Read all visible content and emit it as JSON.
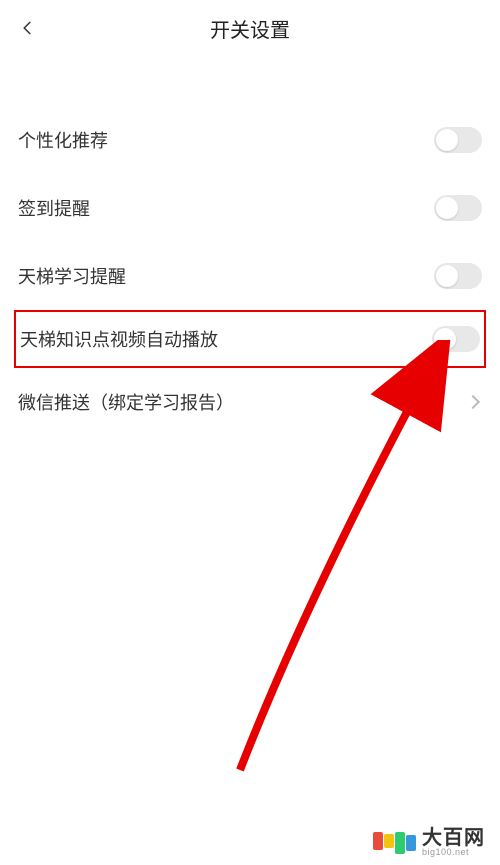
{
  "header": {
    "title": "开关设置"
  },
  "settings": [
    {
      "label": "个性化推荐",
      "type": "toggle",
      "on": false,
      "highlighted": false
    },
    {
      "label": "签到提醒",
      "type": "toggle",
      "on": false,
      "highlighted": false
    },
    {
      "label": "天梯学习提醒",
      "type": "toggle",
      "on": false,
      "highlighted": false
    },
    {
      "label": "天梯知识点视频自动播放",
      "type": "toggle",
      "on": false,
      "highlighted": true
    },
    {
      "label": "微信推送（绑定学习报告）",
      "type": "link",
      "highlighted": false
    }
  ],
  "watermark": {
    "main": "大百网",
    "sub": "big100.net"
  },
  "annotation": {
    "arrow_color": "#e60000"
  }
}
